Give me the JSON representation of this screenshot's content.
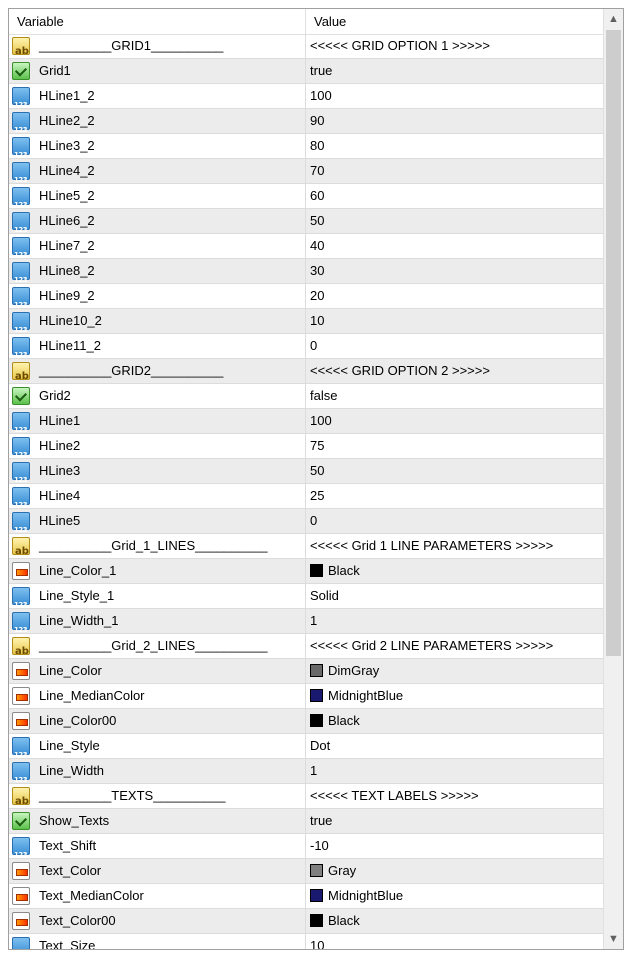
{
  "header": {
    "variable": "Variable",
    "value": "Value"
  },
  "rows": [
    {
      "name": "__________GRID1__________",
      "value": "<<<<< GRID OPTION 1 >>>>>",
      "icon": "string-icon",
      "swatch": ""
    },
    {
      "name": "Grid1",
      "value": "true",
      "icon": "bool-icon",
      "swatch": ""
    },
    {
      "name": "HLine1_2",
      "value": "100",
      "icon": "number-icon",
      "swatch": ""
    },
    {
      "name": "HLine2_2",
      "value": "90",
      "icon": "number-icon",
      "swatch": ""
    },
    {
      "name": "HLine3_2",
      "value": "80",
      "icon": "number-icon",
      "swatch": ""
    },
    {
      "name": "HLine4_2",
      "value": "70",
      "icon": "number-icon",
      "swatch": ""
    },
    {
      "name": "HLine5_2",
      "value": "60",
      "icon": "number-icon",
      "swatch": ""
    },
    {
      "name": "HLine6_2",
      "value": "50",
      "icon": "number-icon",
      "swatch": ""
    },
    {
      "name": "HLine7_2",
      "value": "40",
      "icon": "number-icon",
      "swatch": ""
    },
    {
      "name": "HLine8_2",
      "value": "30",
      "icon": "number-icon",
      "swatch": ""
    },
    {
      "name": "HLine9_2",
      "value": "20",
      "icon": "number-icon",
      "swatch": ""
    },
    {
      "name": "HLine10_2",
      "value": "10",
      "icon": "number-icon",
      "swatch": ""
    },
    {
      "name": "HLine11_2",
      "value": "0",
      "icon": "number-icon",
      "swatch": ""
    },
    {
      "name": "__________GRID2__________",
      "value": "<<<<< GRID OPTION 2 >>>>>",
      "icon": "string-icon",
      "swatch": ""
    },
    {
      "name": "Grid2",
      "value": "false",
      "icon": "bool-icon",
      "swatch": ""
    },
    {
      "name": "HLine1",
      "value": "100",
      "icon": "number-icon",
      "swatch": ""
    },
    {
      "name": "HLine2",
      "value": "75",
      "icon": "number-icon",
      "swatch": ""
    },
    {
      "name": "HLine3",
      "value": "50",
      "icon": "number-icon",
      "swatch": ""
    },
    {
      "name": "HLine4",
      "value": "25",
      "icon": "number-icon",
      "swatch": ""
    },
    {
      "name": "HLine5",
      "value": "0",
      "icon": "number-icon",
      "swatch": ""
    },
    {
      "name": "__________Grid_1_LINES__________",
      "value": "<<<<< Grid 1 LINE PARAMETERS >>>>>",
      "icon": "string-icon",
      "swatch": ""
    },
    {
      "name": "Line_Color_1",
      "value": "Black",
      "icon": "color-icon",
      "swatch": "#000000"
    },
    {
      "name": "Line_Style_1",
      "value": "Solid",
      "icon": "number-icon",
      "swatch": ""
    },
    {
      "name": "Line_Width_1",
      "value": "1",
      "icon": "number-icon",
      "swatch": ""
    },
    {
      "name": "__________Grid_2_LINES__________",
      "value": "<<<<< Grid 2 LINE PARAMETERS >>>>>",
      "icon": "string-icon",
      "swatch": ""
    },
    {
      "name": "Line_Color",
      "value": "DimGray",
      "icon": "color-icon",
      "swatch": "#696969"
    },
    {
      "name": "Line_MedianColor",
      "value": "MidnightBlue",
      "icon": "color-icon",
      "swatch": "#191970"
    },
    {
      "name": "Line_Color00",
      "value": "Black",
      "icon": "color-icon",
      "swatch": "#000000"
    },
    {
      "name": "Line_Style",
      "value": "Dot",
      "icon": "number-icon",
      "swatch": ""
    },
    {
      "name": "Line_Width",
      "value": "1",
      "icon": "number-icon",
      "swatch": ""
    },
    {
      "name": "__________TEXTS__________",
      "value": "<<<<< TEXT LABELS >>>>>",
      "icon": "string-icon",
      "swatch": ""
    },
    {
      "name": "Show_Texts",
      "value": "true",
      "icon": "bool-icon",
      "swatch": ""
    },
    {
      "name": "Text_Shift",
      "value": "-10",
      "icon": "number-icon",
      "swatch": ""
    },
    {
      "name": "Text_Color",
      "value": "Gray",
      "icon": "color-icon",
      "swatch": "#808080"
    },
    {
      "name": "Text_MedianColor",
      "value": "MidnightBlue",
      "icon": "color-icon",
      "swatch": "#191970"
    },
    {
      "name": "Text_Color00",
      "value": "Black",
      "icon": "color-icon",
      "swatch": "#000000"
    },
    {
      "name": "Text_Size",
      "value": "10",
      "icon": "number-icon",
      "swatch": ""
    }
  ],
  "scrollbar": {
    "up_glyph": "▲",
    "down_glyph": "▼"
  }
}
